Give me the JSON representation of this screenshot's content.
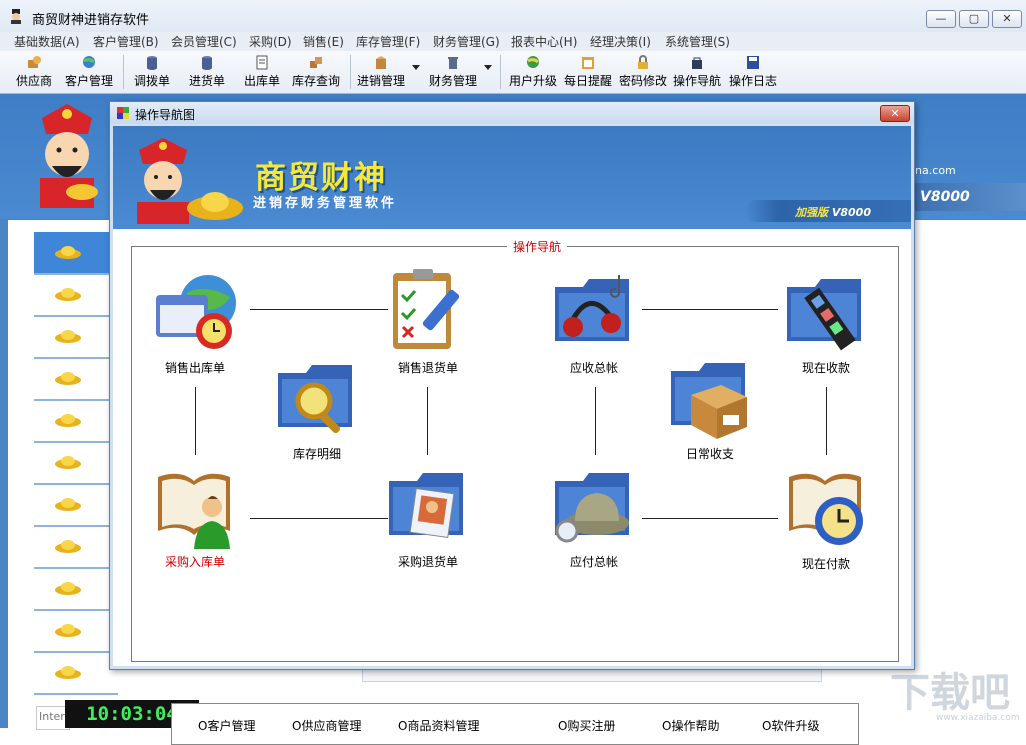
{
  "window": {
    "title": "商贸财神进销存软件",
    "controls": [
      "—",
      "▢",
      "✕"
    ]
  },
  "menubar": [
    "基础数据(A)",
    "客户管理(B)",
    "会员管理(C)",
    "采购(D)",
    "销售(E)",
    "库存管理(F)",
    "财务管理(G)",
    "报表中心(H)",
    "经理决策(I)",
    "系统管理(S)"
  ],
  "toolbar": {
    "supplier": "供应商",
    "customer": "客户管理",
    "transfer": "调拨单",
    "purchase_in": "进货单",
    "stock_out": "出库单",
    "stock_query": "库存查询",
    "sales_mgmt": "进销管理",
    "finance_mgmt": "财务管理",
    "upgrade": "用户升级",
    "reminder": "每日提醒",
    "password": "密码修改",
    "guide": "操作导航",
    "log": "操作日志"
  },
  "background": {
    "url_fragment": "ina.com",
    "version": "V8000",
    "clock": "10:03:04",
    "internet_label": "Internet",
    "watermark": "下载吧",
    "watermark_url": "www.xiazaiba.com"
  },
  "dialog": {
    "title": "操作导航图",
    "close": "✕",
    "brand_title": "商贸财神",
    "brand_subtitle": "进销存财务管理软件",
    "edition_tag": "加强版",
    "edition_version": "V8000",
    "frame_title": "操作导航",
    "nav_items": {
      "sales_out": "销售出库单",
      "sales_return": "销售退货单",
      "receivable": "应收总帐",
      "cash_receipt": "现在收款",
      "stock_detail": "库存明细",
      "daily_expense": "日常收支",
      "purchase_in": "采购入库单",
      "purchase_return": "采购退货单",
      "payable": "应付总帐",
      "cash_payment": "现在付款"
    },
    "links": [
      "O客户管理",
      "O供应商管理",
      "O商品资料管理",
      "O购买注册",
      "O操作帮助",
      "O软件升级"
    ]
  },
  "colors": {
    "banner_blue": "#3f7ec6",
    "brand_yellow": "#f5e83a",
    "highlight_red": "#cc0000",
    "clock_green": "#3ff05a"
  }
}
